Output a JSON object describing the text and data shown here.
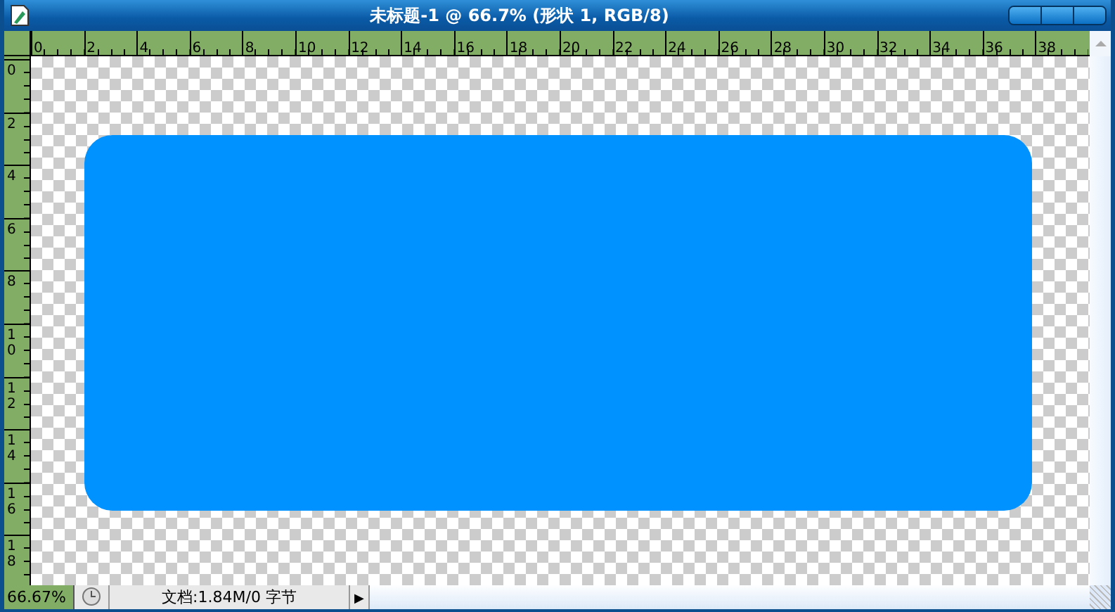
{
  "window": {
    "title": "未标题-1 @ 66.7% (形状 1, RGB/8)"
  },
  "rulers": {
    "horizontal": [
      "0",
      "2",
      "4",
      "6",
      "8",
      "10",
      "12",
      "14",
      "16",
      "18",
      "20",
      "22",
      "24",
      "26",
      "28",
      "30",
      "32",
      "34",
      "36",
      "38"
    ],
    "vertical": [
      "0",
      "2",
      "4",
      "6",
      "8",
      "10",
      "12",
      "14",
      "16",
      "18"
    ]
  },
  "status_bar": {
    "zoom": "66.67%",
    "document_info": "文档:1.84M/0 字节",
    "menu_arrow": "▶"
  }
}
